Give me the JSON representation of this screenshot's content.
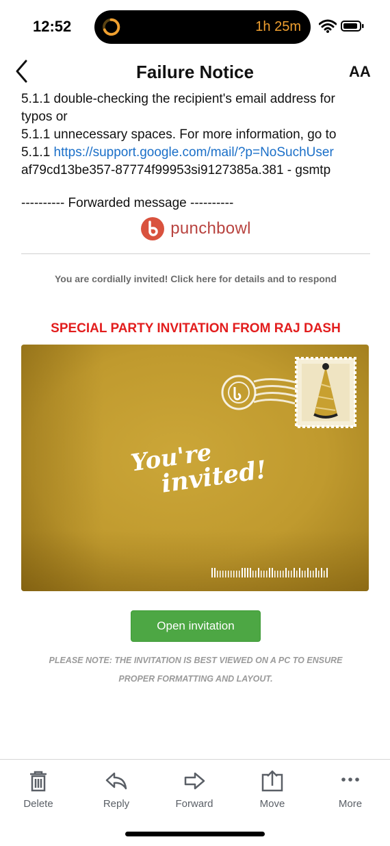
{
  "status_bar": {
    "time": "12:52",
    "timer": "1h 25m"
  },
  "header": {
    "title": "Failure Notice",
    "text_size_label": "AA"
  },
  "bounce_lines": [
    "5.1.1 double-checking the recipient's email address for",
    "typos or",
    "5.1.1 unnecessary spaces. For more information, go to",
    "af79cd13be357-87774f99953si9127385a.381 - gsmtp"
  ],
  "bounce_link": {
    "prefix": "5.1.1 ",
    "url": "https://support.google.com/mail/?p=NoSuchUser"
  },
  "forwarded_label": "---------- Forwarded message ----------",
  "logo_text": "punchbowl",
  "cordial_text": "You are cordially invited! Click here for details and to respond",
  "invitation_title": "SPECIAL PARTY INVITATION FROM  RAJ DASH",
  "card": {
    "line1": "You're",
    "line2": "invited!"
  },
  "open_button": "Open invitation",
  "note": "PLEASE NOTE: THE INVITATION IS BEST VIEWED ON A PC TO ENSURE PROPER FORMATTING AND LAYOUT.",
  "toolbar": {
    "delete": "Delete",
    "reply": "Reply",
    "forward": "Forward",
    "move": "Move",
    "more": "More"
  },
  "colors": {
    "link": "#1a6fc8",
    "title_red": "#e21d1d",
    "button_green": "#4da744",
    "card_gold": "#c09a2e",
    "logo_red": "#b8433f"
  }
}
